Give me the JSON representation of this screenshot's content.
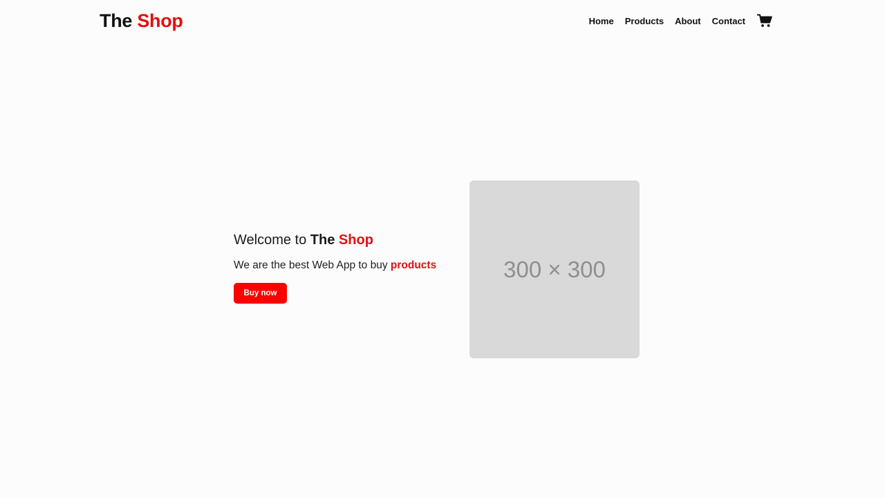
{
  "brand": {
    "part1": "The",
    "part2": "Shop",
    "accent_color": "#e20f0f"
  },
  "nav": {
    "items": [
      {
        "label": "Home"
      },
      {
        "label": "Products"
      },
      {
        "label": "About"
      },
      {
        "label": "Contact"
      }
    ],
    "cart_icon": "shopping-cart-icon"
  },
  "hero": {
    "title_prefix": "Welcome to",
    "title_brand1": "The",
    "title_brand2": "Shop",
    "subtitle_prefix": "We are the best Web App to buy",
    "subtitle_highlight": "products",
    "button_label": "Buy now",
    "button_color": "#ff0000",
    "image_placeholder": "300 × 300"
  }
}
